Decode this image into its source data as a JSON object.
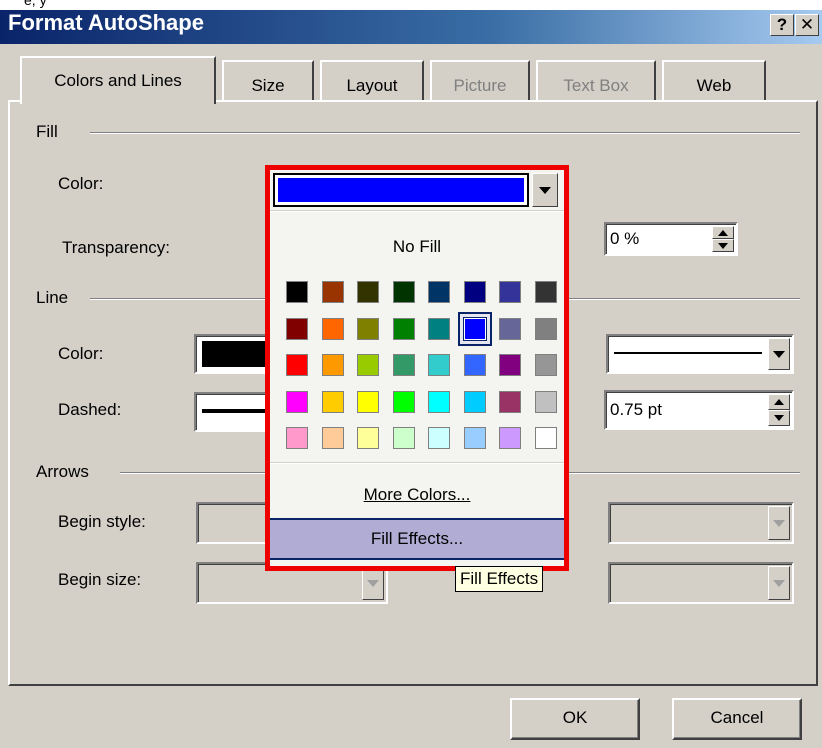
{
  "window": {
    "title": "Format AutoShape",
    "help_label": "?",
    "close_label": "✕",
    "top_cut_text": "e, y"
  },
  "tabs": [
    {
      "label": "Colors and Lines",
      "state": "active"
    },
    {
      "label": "Size",
      "state": "normal"
    },
    {
      "label": "Layout",
      "state": "normal"
    },
    {
      "label": "Picture",
      "state": "disabled"
    },
    {
      "label": "Text Box",
      "state": "disabled"
    },
    {
      "label": "Web",
      "state": "normal"
    }
  ],
  "fill": {
    "group_label": "Fill",
    "color_label": "Color:",
    "transparency_label": "Transparency:",
    "transparency_value": "0 %"
  },
  "line": {
    "group_label": "Line",
    "color_label": "Color:",
    "dashed_label": "Dashed:",
    "weight_value": "0.75 pt"
  },
  "arrows": {
    "group_label": "Arrows",
    "begin_style_label": "Begin style:",
    "begin_size_label": "Begin size:"
  },
  "color_popup": {
    "selected_color": "#0000ff",
    "no_fill_label": "No Fill",
    "more_colors_label": "More Colors...",
    "fill_effects_label": "Fill Effects...",
    "highlight_border_color": "#ee0000",
    "palette": [
      [
        "#000000",
        "#993300",
        "#333300",
        "#003300",
        "#003366",
        "#000080",
        "#333399",
        "#333333"
      ],
      [
        "#800000",
        "#ff6600",
        "#808000",
        "#008000",
        "#008080",
        "#0000ff",
        "#666699",
        "#808080"
      ],
      [
        "#ff0000",
        "#ff9900",
        "#99cc00",
        "#339966",
        "#33cccc",
        "#3366ff",
        "#800080",
        "#969696"
      ],
      [
        "#ff00ff",
        "#ffcc00",
        "#ffff00",
        "#00ff00",
        "#00ffff",
        "#00ccff",
        "#993366",
        "#c0c0c0"
      ],
      [
        "#ff99cc",
        "#ffcc99",
        "#ffff99",
        "#ccffcc",
        "#ccffff",
        "#99ccff",
        "#cc99ff",
        "#ffffff"
      ]
    ],
    "selected_cell": [
      1,
      5
    ]
  },
  "tooltip": {
    "text": "Fill Effects"
  },
  "buttons": {
    "ok_label": "OK",
    "cancel_label": "Cancel"
  }
}
